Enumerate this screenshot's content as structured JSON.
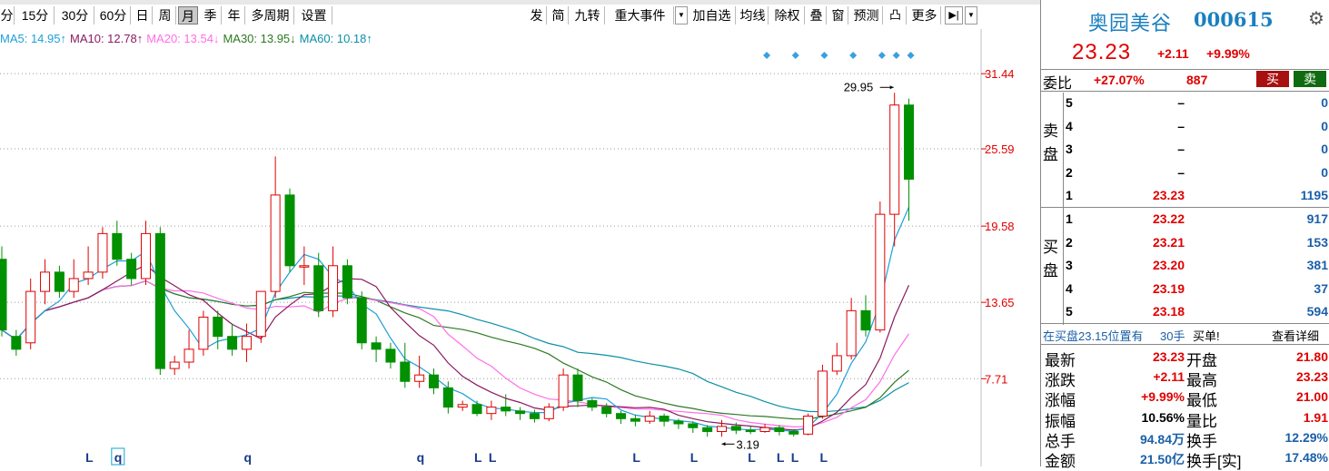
{
  "toolbar": {
    "periods": [
      "分",
      "15分",
      "30分",
      "60分",
      "日",
      "周",
      "月",
      "季",
      "年",
      "多周期",
      "设置"
    ],
    "selected_period": "月",
    "tools": [
      "发",
      "简",
      "九转",
      "重大事件",
      "加自选",
      "均线",
      "除权",
      "叠",
      "窗",
      "预测",
      "",
      "更多"
    ],
    "flagged_tools": [
      "简",
      "九转",
      "重大事件"
    ]
  },
  "ma_legend": [
    {
      "label": "MA5: 14.95↑",
      "color": "#1e9fd8"
    },
    {
      "label": "MA10: 12.78↑",
      "color": "#8b1a60"
    },
    {
      "label": "MA20: 13.54↓",
      "color": "#ff6ee8"
    },
    {
      "label": "MA30: 13.95↓",
      "color": "#2b7a22"
    },
    {
      "label": "MA60: 10.18↑",
      "color": "#0b8fa8"
    }
  ],
  "chart_data": {
    "type": "candlestick",
    "price_axis_labels": [
      "31.44",
      "25.59",
      "19.58",
      "13.65",
      "7.71"
    ],
    "ylim": [
      3.0,
      33.5
    ],
    "up_color": "#e00000",
    "down_color": "#009000",
    "annotations": {
      "high": "29.95",
      "low": "3.19"
    },
    "x_markers": [
      {
        "label": "L",
        "i": 6
      },
      {
        "label": "q",
        "i": 8
      },
      {
        "label": "q",
        "i": 17
      },
      {
        "label": "q",
        "i": 29
      },
      {
        "label": "L",
        "i": 33
      },
      {
        "label": "L",
        "i": 34
      },
      {
        "label": "L",
        "i": 44
      },
      {
        "label": "L",
        "i": 48
      },
      {
        "label": "L",
        "i": 52
      },
      {
        "label": "L",
        "i": 54
      },
      {
        "label": "L",
        "i": 55
      },
      {
        "label": "L",
        "i": 57
      }
    ],
    "diamonds": [
      53,
      55,
      57,
      59,
      61,
      62,
      63
    ],
    "candles": [
      [
        17.0,
        11.5,
        18.0,
        11.0
      ],
      [
        11.0,
        10.0,
        11.5,
        9.5
      ],
      [
        10.5,
        14.5,
        15.5,
        10.0
      ],
      [
        14.5,
        16.0,
        17.0,
        13.5
      ],
      [
        16.0,
        14.5,
        16.5,
        14.0
      ],
      [
        14.5,
        15.5,
        17.0,
        14.0
      ],
      [
        15.5,
        16.0,
        18.0,
        15.0
      ],
      [
        16.0,
        19.0,
        19.5,
        15.5
      ],
      [
        19.0,
        17.0,
        20.0,
        16.5
      ],
      [
        17.0,
        15.5,
        17.5,
        15.0
      ],
      [
        15.5,
        19.0,
        20.0,
        15.0
      ],
      [
        19.0,
        8.5,
        19.5,
        8.0
      ],
      [
        8.5,
        9.0,
        9.5,
        8.0
      ],
      [
        9.0,
        10.0,
        11.5,
        8.5
      ],
      [
        10.0,
        12.5,
        13.0,
        9.5
      ],
      [
        12.5,
        11.0,
        13.0,
        10.0
      ],
      [
        11.0,
        10.0,
        12.0,
        9.5
      ],
      [
        10.0,
        11.0,
        12.0,
        9.0
      ],
      [
        11.0,
        14.5,
        14.5,
        10.5
      ],
      [
        14.5,
        22.0,
        25.0,
        14.0
      ],
      [
        22.0,
        16.5,
        22.5,
        16.0
      ],
      [
        16.5,
        16.5,
        18.0,
        15.0
      ],
      [
        16.5,
        13.0,
        17.5,
        12.5
      ],
      [
        13.0,
        16.5,
        18.0,
        12.5
      ],
      [
        16.5,
        14.0,
        17.0,
        13.5
      ],
      [
        14.0,
        10.5,
        14.5,
        10.0
      ],
      [
        10.5,
        10.0,
        11.0,
        9.0
      ],
      [
        10.0,
        9.0,
        10.5,
        8.5
      ],
      [
        9.0,
        7.5,
        10.5,
        7.0
      ],
      [
        7.5,
        8.0,
        9.5,
        7.0
      ],
      [
        8.0,
        7.0,
        8.5,
        6.5
      ],
      [
        7.0,
        5.5,
        7.5,
        5.0
      ],
      [
        5.5,
        5.7,
        6.0,
        5.2
      ],
      [
        5.7,
        5.0,
        6.0,
        4.8
      ],
      [
        5.0,
        5.5,
        6.0,
        4.5
      ],
      [
        5.5,
        5.2,
        6.5,
        4.8
      ],
      [
        5.2,
        5.0,
        5.5,
        4.5
      ],
      [
        5.0,
        4.6,
        5.3,
        4.3
      ],
      [
        4.6,
        5.5,
        5.8,
        4.4
      ],
      [
        5.5,
        8.0,
        8.5,
        5.2
      ],
      [
        8.0,
        6.0,
        8.5,
        5.5
      ],
      [
        6.0,
        5.5,
        6.2,
        5.2
      ],
      [
        5.5,
        5.0,
        5.8,
        4.7
      ],
      [
        5.0,
        4.6,
        5.2,
        4.2
      ],
      [
        4.6,
        4.4,
        4.9,
        4.0
      ],
      [
        4.4,
        4.8,
        5.2,
        4.2
      ],
      [
        4.8,
        4.4,
        5.0,
        4.0
      ],
      [
        4.4,
        4.2,
        4.6,
        3.8
      ],
      [
        4.2,
        3.9,
        4.4,
        3.5
      ],
      [
        3.9,
        3.6,
        4.1,
        3.2
      ],
      [
        3.6,
        4.0,
        4.5,
        3.19
      ],
      [
        4.0,
        3.7,
        4.3,
        3.4
      ],
      [
        3.7,
        3.6,
        4.0,
        3.4
      ],
      [
        3.6,
        3.9,
        4.2,
        3.5
      ],
      [
        3.9,
        3.6,
        4.1,
        3.3
      ],
      [
        3.6,
        3.4,
        3.8,
        3.2
      ],
      [
        3.4,
        4.8,
        5.0,
        3.3
      ],
      [
        4.8,
        8.3,
        8.8,
        4.6
      ],
      [
        8.3,
        9.5,
        10.5,
        8.0
      ],
      [
        9.5,
        13.0,
        14.0,
        9.2
      ],
      [
        13.0,
        11.5,
        14.2,
        11.0
      ],
      [
        11.5,
        20.5,
        21.5,
        11.3
      ],
      [
        20.5,
        29.0,
        29.95,
        18.0
      ],
      [
        29.0,
        23.23,
        29.5,
        20.0
      ]
    ],
    "ma_series": {
      "MA5": {
        "color": "#1e9fd8",
        "start": 4,
        "end": 64,
        "values_first": [
          15.0,
          15.3,
          15.8,
          16.4
        ],
        "last": 19.5
      },
      "MA10": {
        "color": "#8b1a60",
        "end": 64,
        "last": 12.78
      },
      "MA20": {
        "color": "#ff6ee8",
        "end": 64,
        "last": 8.0
      },
      "MA30": {
        "color": "#2b7a22",
        "end": 64,
        "last": 7.0
      },
      "MA60": {
        "color": "#0b8fa8",
        "end": 64,
        "last": 9.0
      }
    }
  },
  "quote": {
    "name": "奥园美谷",
    "code": "000615",
    "price": "23.23",
    "change": "+2.11",
    "change_pct": "+9.99%",
    "weibi_label": "委比",
    "weibi_pct": "+27.07%",
    "weibi_vol": "887",
    "buy_btn": "买",
    "sell_btn": "卖",
    "sell_label": [
      "卖",
      "盘"
    ],
    "buy_label": [
      "买",
      "盘"
    ],
    "asks": [
      {
        "lvl": "5",
        "price": "–",
        "vol": "0"
      },
      {
        "lvl": "4",
        "price": "–",
        "vol": "0"
      },
      {
        "lvl": "3",
        "price": "–",
        "vol": "0"
      },
      {
        "lvl": "2",
        "price": "–",
        "vol": "0"
      },
      {
        "lvl": "1",
        "price": "23.23",
        "vol": "1195"
      }
    ],
    "bids": [
      {
        "lvl": "1",
        "price": "23.22",
        "vol": "917"
      },
      {
        "lvl": "2",
        "price": "23.21",
        "vol": "153"
      },
      {
        "lvl": "3",
        "price": "23.20",
        "vol": "381"
      },
      {
        "lvl": "4",
        "price": "23.19",
        "vol": "37"
      },
      {
        "lvl": "5",
        "price": "23.18",
        "vol": "594"
      }
    ],
    "ticker_prefix": "在买盘23.15位置有",
    "ticker_qty": "30手",
    "ticker_suffix": "买单!",
    "ticker_link": "查看详细",
    "stats": [
      {
        "l1": "最新",
        "v1": "23.23",
        "l2": "开盘",
        "v2": "21.80"
      },
      {
        "l1": "涨跌",
        "v1": "+2.11",
        "l2": "最高",
        "v2": "23.23"
      },
      {
        "l1": "涨幅",
        "v1": "+9.99%",
        "l2": "最低",
        "v2": "21.00"
      },
      {
        "l1": "振幅",
        "v1": "10.56%",
        "l2": "量比",
        "v2": "1.91"
      },
      {
        "l1": "总手",
        "v1": "94.84万",
        "l2": "换手",
        "v2": "12.29%"
      },
      {
        "l1": "金额",
        "v1": "21.50亿",
        "l2": "换手[实]",
        "v2": "17.48%"
      }
    ]
  }
}
